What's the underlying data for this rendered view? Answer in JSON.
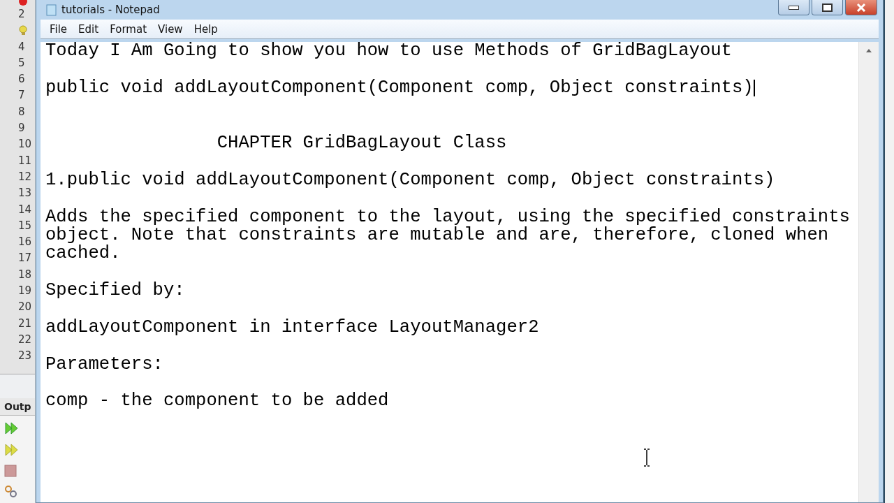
{
  "ide": {
    "gutter": [
      {
        "kind": "number",
        "label": "2"
      },
      {
        "kind": "lightbulb"
      },
      {
        "kind": "number",
        "label": "4"
      },
      {
        "kind": "number",
        "label": "5"
      },
      {
        "kind": "number",
        "label": "6"
      },
      {
        "kind": "number",
        "label": "7"
      },
      {
        "kind": "number",
        "label": "8"
      },
      {
        "kind": "number",
        "label": "9"
      },
      {
        "kind": "number",
        "label": "10"
      },
      {
        "kind": "number",
        "label": "11"
      },
      {
        "kind": "number",
        "label": "12"
      },
      {
        "kind": "number",
        "label": "13"
      },
      {
        "kind": "number",
        "label": "14"
      },
      {
        "kind": "number",
        "label": "15"
      },
      {
        "kind": "number",
        "label": "16"
      },
      {
        "kind": "number",
        "label": "17"
      },
      {
        "kind": "number",
        "label": "18"
      },
      {
        "kind": "number",
        "label": "19"
      },
      {
        "kind": "number",
        "label": "20"
      },
      {
        "kind": "number",
        "label": "21"
      },
      {
        "kind": "number",
        "label": "22"
      },
      {
        "kind": "number",
        "label": "23"
      }
    ],
    "output_tab": "Outp"
  },
  "window": {
    "title": "tutorials - Notepad"
  },
  "menu": [
    "File",
    "Edit",
    "Format",
    "View",
    "Help"
  ],
  "editor": {
    "lines": [
      {
        "kind": "text",
        "text": "Today I Am Going to show you how to use Methods of GridBagLayout",
        "caret": false
      },
      {
        "kind": "blank"
      },
      {
        "kind": "text",
        "text": "public void addLayoutComponent(Component comp, Object constraints)",
        "caret": true
      },
      {
        "kind": "blank"
      },
      {
        "kind": "blank"
      },
      {
        "kind": "text",
        "text": "                CHAPTER GridBagLayout Class",
        "caret": false
      },
      {
        "kind": "blank"
      },
      {
        "kind": "text",
        "text": "1.public void addLayoutComponent(Component comp, Object constraints)",
        "caret": false
      },
      {
        "kind": "blank"
      },
      {
        "kind": "text",
        "text": "Adds the specified component to the layout, using the specified constraints",
        "caret": false
      },
      {
        "kind": "text",
        "text": "object. Note that constraints are mutable and are, therefore, cloned when",
        "caret": false
      },
      {
        "kind": "text",
        "text": "cached.",
        "caret": false
      },
      {
        "kind": "blank"
      },
      {
        "kind": "text",
        "text": "Specified by:",
        "caret": false
      },
      {
        "kind": "blank"
      },
      {
        "kind": "text",
        "text": "addLayoutComponent in interface LayoutManager2",
        "caret": false
      },
      {
        "kind": "blank"
      },
      {
        "kind": "text",
        "text": "Parameters:",
        "caret": false
      },
      {
        "kind": "blank"
      },
      {
        "kind": "text",
        "text": "comp - the component to be added",
        "caret": false
      }
    ]
  }
}
